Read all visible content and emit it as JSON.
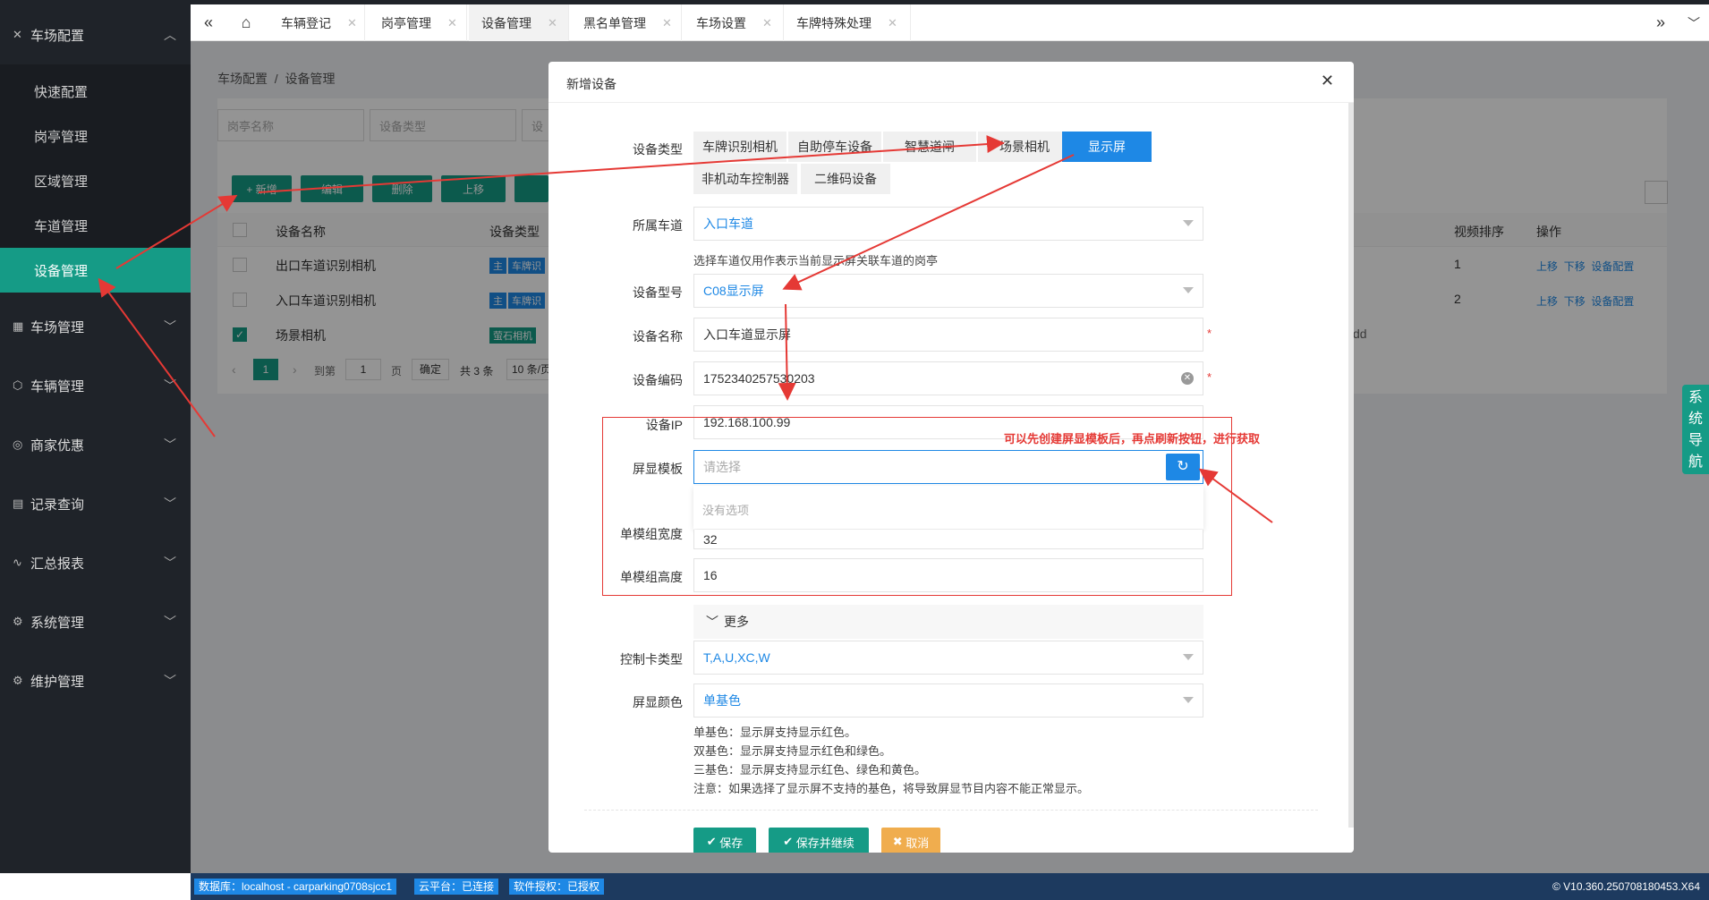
{
  "sidebar": {
    "top_group": "车场配置",
    "sub_items": [
      "快速配置",
      "岗亭管理",
      "区域管理",
      "车道管理",
      "设备管理"
    ],
    "groups": [
      "车场管理",
      "车辆管理",
      "商家优惠",
      "记录查询",
      "汇总报表",
      "系统管理",
      "维护管理"
    ]
  },
  "tabs": [
    "车辆登记",
    "岗亭管理",
    "设备管理",
    "黑名单管理",
    "车场设置",
    "车牌特殊处理"
  ],
  "breadcrumb": {
    "root": "车场配置",
    "sep": "/",
    "current": "设备管理"
  },
  "filters": [
    "岗亭名称",
    "设备类型",
    "设"
  ],
  "toolbar": {
    "add": "+ 新增",
    "edit": "编辑",
    "delete": "删除",
    "up": "上移",
    "down": ""
  },
  "table": {
    "headers": [
      "设备名称",
      "设备类型",
      "视频排序",
      "操作"
    ],
    "rows": [
      {
        "name": "出口车道识别相机",
        "tag1": "主",
        "tag2": "车牌识",
        "order": "1",
        "ops": [
          "上移",
          "下移",
          "设备配置"
        ],
        "checked": false
      },
      {
        "name": "入口车道识别相机",
        "tag1": "主",
        "tag2": "车牌识",
        "order": "2",
        "ops": [
          "上移",
          "下移",
          "设备配置"
        ],
        "checked": false
      },
      {
        "name": "场景相机",
        "tag1": "萤石相机",
        "tag2": "",
        "order": "",
        "ops": [],
        "extra": "dd",
        "checked": true
      }
    ]
  },
  "pager": {
    "page": "1",
    "goto_label": "到第",
    "goto_val": "1",
    "page_unit": "页",
    "confirm": "确定",
    "total": "共 3 条",
    "per_page": "10 条/页"
  },
  "modal": {
    "title": "新增设备",
    "device_type_label": "设备类型",
    "device_types": [
      "车牌识别相机",
      "自助停车设备",
      "智慧道闸",
      "场景相机",
      "显示屏",
      "非机动车控制器",
      "二维码设备"
    ],
    "selected_type": "显示屏",
    "lane_label": "所属车道",
    "lane_value": "入口车道",
    "lane_hint": "选择车道仅用作表示当前显示屏关联车道的岗亭",
    "model_label": "设备型号",
    "model_value": "C08显示屏",
    "name_label": "设备名称",
    "name_value": "入口车道显示屏",
    "code_label": "设备编码",
    "code_value": "1752340257530203",
    "ip_label": "设备IP",
    "ip_value": "192.168.100.99",
    "template_label": "屏显模板",
    "template_placeholder": "请选择",
    "template_empty": "没有选项",
    "width_label": "单模组宽度",
    "width_value": "32",
    "height_label": "单模组高度",
    "height_value": "16",
    "more_label": "更多",
    "card_label": "控制卡类型",
    "card_value": "T,A,U,XC,W",
    "color_label": "屏显颜色",
    "color_value": "单基色",
    "color_notes": [
      "单基色：显示屏支持显示红色。",
      "双基色：显示屏支持显示红色和绿色。",
      "三基色：显示屏支持显示红色、绿色和黄色。",
      "注意：如果选择了显示屏不支持的基色，将导致屏显节目内容不能正常显示。"
    ],
    "save": "保存",
    "save_continue": "保存并继续",
    "cancel": "取消",
    "required_mark": "*"
  },
  "annotation": "可以先创建屏显模板后，再点刷新按钮，进行获取",
  "status": {
    "db": "数据库：localhost - carparking0708sjcc1",
    "cloud": "云平台：已连接",
    "license": "软件授权：已授权",
    "version": "© V10.360.250708180453.X64"
  },
  "sysnav": [
    "系",
    "统",
    "导",
    "航"
  ],
  "colors": {
    "accent": "#159b86",
    "blue": "#1e88e5",
    "annotation_red": "#e53935",
    "sidebar": "#1f2329"
  }
}
